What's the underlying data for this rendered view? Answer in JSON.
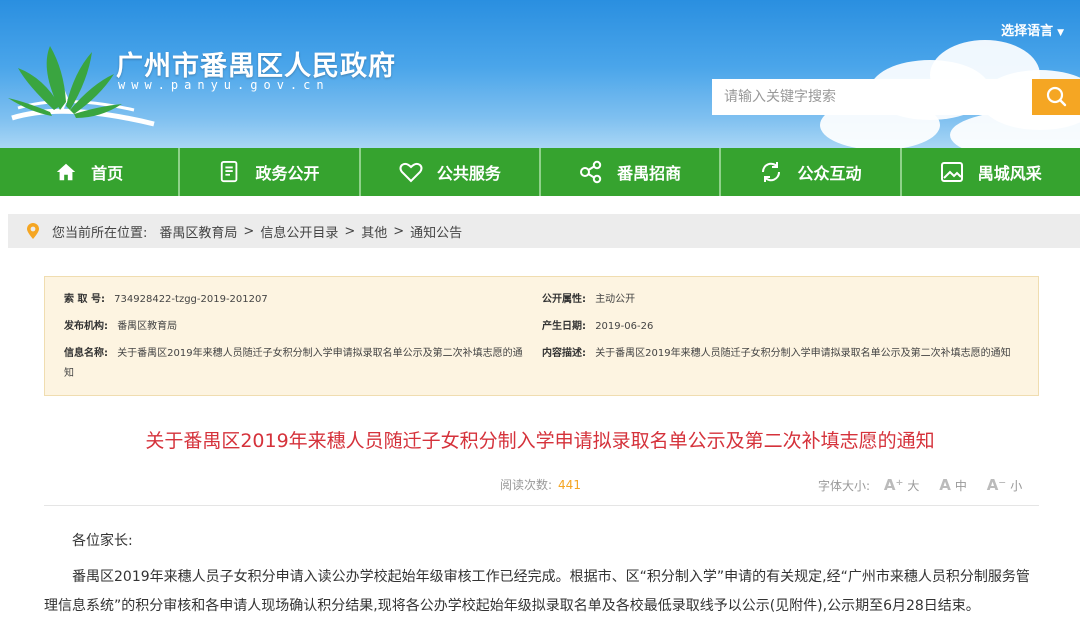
{
  "header": {
    "site_title": "广州市番禺区人民政府",
    "site_url": "www.panyu.gov.cn",
    "lang_label": "选择语言",
    "search_placeholder": "请输入关键字搜索"
  },
  "nav": {
    "items": [
      {
        "label": "首页",
        "icon": "home-icon"
      },
      {
        "label": "政务公开",
        "icon": "document-icon"
      },
      {
        "label": "公共服务",
        "icon": "heart-icon"
      },
      {
        "label": "番禺招商",
        "icon": "share-icon"
      },
      {
        "label": "公众互动",
        "icon": "refresh-icon"
      },
      {
        "label": "禺城风采",
        "icon": "image-icon"
      }
    ]
  },
  "breadcrumb": {
    "prefix": "您当前所在位置:",
    "items": [
      "番禺区教育局",
      "信息公开目录",
      "其他",
      "通知公告"
    ],
    "separator": ">"
  },
  "info": {
    "index_label": "索 取 号:",
    "index_value": "734928422-tzgg-2019-201207",
    "public_attr_label": "公开属性:",
    "public_attr_value": "主动公开",
    "publisher_label": "发布机构:",
    "publisher_value": "番禺区教育局",
    "date_label": "产生日期:",
    "date_value": "2019-06-26",
    "name_label": "信息名称:",
    "name_value": "关于番禺区2019年来穗人员随迁子女积分制入学申请拟录取名单公示及第二次补填志愿的通知",
    "desc_label": "内容描述:",
    "desc_value": "关于番禺区2019年来穗人员随迁子女积分制入学申请拟录取名单公示及第二次补填志愿的通知"
  },
  "article": {
    "title": "关于番禺区2019年来穗人员随迁子女积分制入学申请拟录取名单公示及第二次补填志愿的通知",
    "reads_label": "阅读次数:",
    "reads_count": "441",
    "font_size_label": "字体大小:",
    "font_big": "A⁺",
    "font_big_label": "大",
    "font_mid": "A",
    "font_mid_label": "中",
    "font_small": "A⁻",
    "font_small_label": "小",
    "greeting": "各位家长:",
    "paragraph": "番禺区2019年来穗人员子女积分申请入读公办学校起始年级审核工作已经完成。根据市、区“积分制入学”申请的有关规定,经“广州市来穗人员积分制服务管理信息系统”的积分审核和各申请人现场确认积分结果,现将各公办学校起始年级拟录取名单及各校最低录取线予以公示(见附件),公示期至6月28日结束。"
  },
  "colors": {
    "nav_green": "#36a32f",
    "title_red": "#d5323b",
    "search_orange": "#f5a623",
    "info_bg": "#fdf4e1"
  }
}
